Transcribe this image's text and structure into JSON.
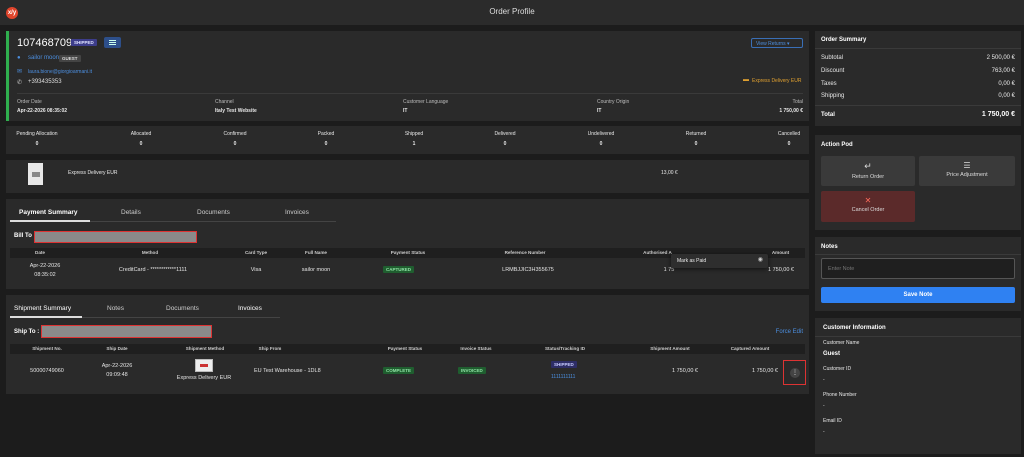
{
  "app": {
    "logo_text": "x/y",
    "title": "Order Profile"
  },
  "order": {
    "number": "107468709",
    "status_badge": "SHIPPED",
    "customer_name": "sailor moon",
    "customer_type_badge": "GUEST",
    "email": "laura.bione@giorgioarmani.it",
    "phone": "+393435353",
    "view_returns_label": "View Returns",
    "delivery_method": "Express Delivery EUR",
    "meta": [
      {
        "label": "Order Date",
        "value": "Apr-22-2026 08:35:02"
      },
      {
        "label": "Channel",
        "value": "Italy Test Website"
      },
      {
        "label": "Customer Language",
        "value": "IT"
      },
      {
        "label": "Country Origin",
        "value": "IT"
      },
      {
        "label": "Total",
        "value": "1 750,00 €"
      }
    ]
  },
  "status_counts": [
    {
      "label": "Pending Allocation",
      "value": "0"
    },
    {
      "label": "Allocated",
      "value": "0"
    },
    {
      "label": "Confirmed",
      "value": "0"
    },
    {
      "label": "Packed",
      "value": "0"
    },
    {
      "label": "Shipped",
      "value": "1"
    },
    {
      "label": "Delivered",
      "value": "0"
    },
    {
      "label": "Undelivered",
      "value": "0"
    },
    {
      "label": "Returned",
      "value": "0"
    },
    {
      "label": "Cancelled",
      "value": "0"
    }
  ],
  "shipping_line": {
    "name": "Express Delivery EUR",
    "amount": "13,00 €"
  },
  "payment": {
    "tabs": [
      "Payment Summary",
      "Details",
      "Documents",
      "Invoices"
    ],
    "bill_to_label": "Bill To",
    "columns": [
      "Date",
      "Method",
      "Card Type",
      "Full Name",
      "Payment Status",
      "Reference Number",
      "Authorised A",
      "Amount"
    ],
    "row": {
      "date": "Apr-22-2026",
      "time": "08:35:02",
      "method": "CreditCard - ************1111",
      "card_type": "Visa",
      "full_name": "sailor moon",
      "status": "CAPTURED",
      "reference": "LRMBJJIC3H355675",
      "authorised": "1 75",
      "amount": "1 750,00 €"
    },
    "tooltip": "Mark as Paid"
  },
  "shipment": {
    "tabs": [
      "Shipment Summary",
      "Notes",
      "Documents",
      "Invoices"
    ],
    "ship_to_label": "Ship To :",
    "force_edit_label": "Force Edit",
    "columns": [
      "Shipment No.",
      "Ship Date",
      "Shipment Method",
      "Ship From",
      "Payment Status",
      "Invoice Status",
      "Status/Tracking ID",
      "Shipment Amount",
      "Captured Amount"
    ],
    "row": {
      "number": "50000749060",
      "date": "Apr-22-2026",
      "time": "09:09:48",
      "method": "Express Delivery EUR",
      "ship_from": "EU Test Warehouse - 1DL8",
      "payment_status": "COMPLETE",
      "invoice_status": "INVOICED",
      "status": "SHIPPED",
      "tracking": "1111111111",
      "shipment_amount": "1 750,00 €",
      "captured_amount": "1 750,00 €"
    }
  },
  "summary": {
    "title": "Order Summary",
    "rows": [
      {
        "label": "Subtotal",
        "value": "2 500,00 €"
      },
      {
        "label": "Discount",
        "value": "763,00 €"
      },
      {
        "label": "Taxes",
        "value": "0,00 €"
      },
      {
        "label": "Shipping",
        "value": "0,00 €"
      }
    ],
    "total_label": "Total",
    "total_value": "1 750,00 €"
  },
  "action_pod": {
    "title": "Action Pod",
    "return": "Return Order",
    "price": "Price Adjustment",
    "cancel": "Cancel Order"
  },
  "notes": {
    "title": "Notes",
    "placeholder": "Enter Note",
    "save": "Save Note"
  },
  "customer_info": {
    "title": "Customer Information",
    "fields": [
      {
        "label": "Customer Name",
        "value": "Guest"
      },
      {
        "label": "Customer ID",
        "value": "-"
      },
      {
        "label": "Phone Number",
        "value": "-"
      },
      {
        "label": "Email ID",
        "value": "-"
      }
    ]
  },
  "colors": {
    "accent": "#2f81f2",
    "green": "#2fae4e",
    "cancel_bg": "#5b2a2a",
    "danger": "#e0452c"
  }
}
